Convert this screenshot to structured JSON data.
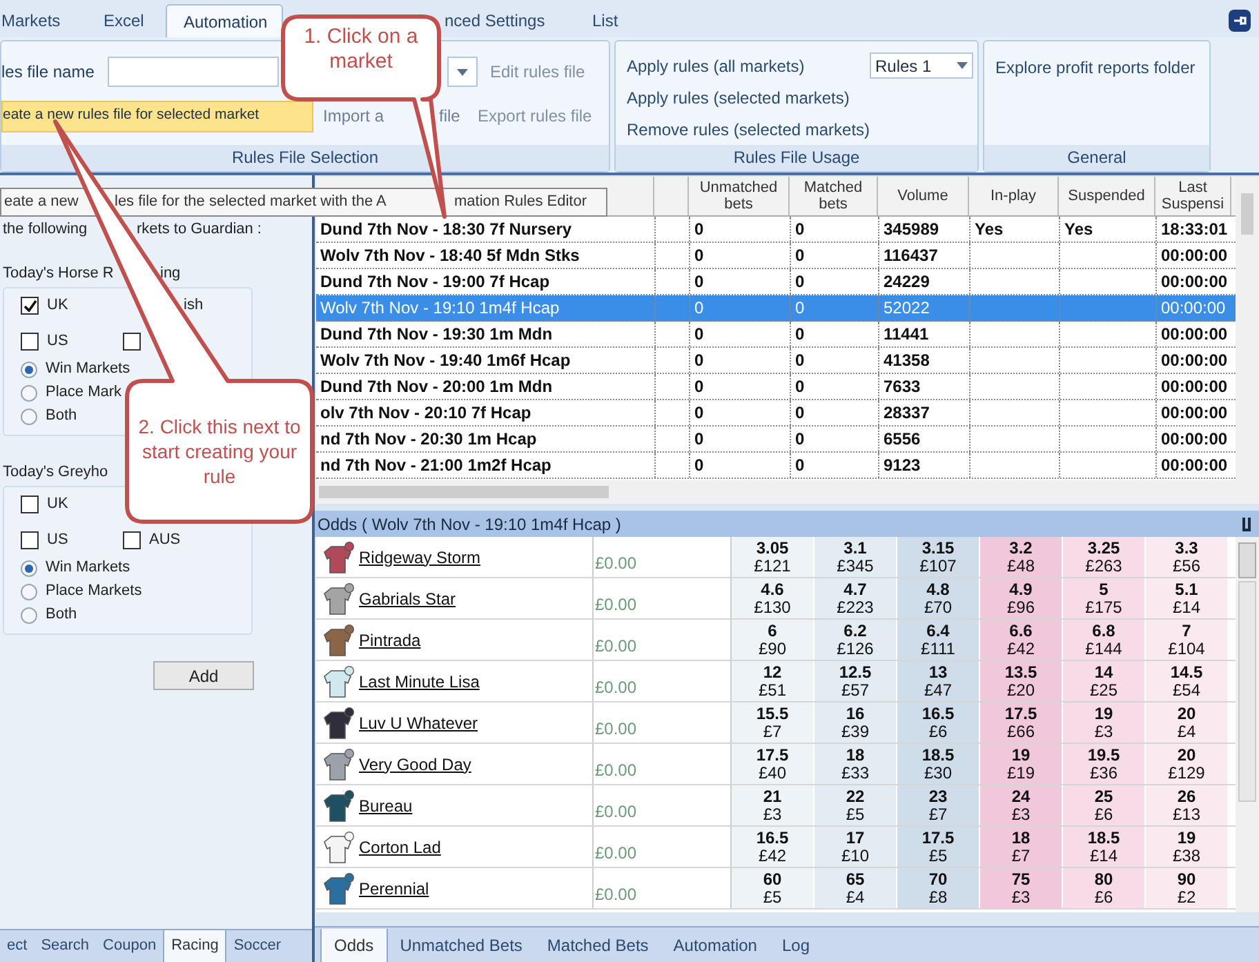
{
  "ribbon_tabs": [
    {
      "label": "Markets",
      "selected": false
    },
    {
      "label": "Excel",
      "selected": false
    },
    {
      "label": "Automation",
      "selected": true
    },
    {
      "label": "nced Settings",
      "selected": false
    },
    {
      "label": "List",
      "selected": false
    }
  ],
  "rules_selection": {
    "name_label": "les file name",
    "edit_button": "Edit rules file",
    "create_button": "eate a new rules file for selected market",
    "import_fragments": [
      "Import a",
      "file"
    ],
    "export_button": "Export rules file",
    "group_label": "Rules File Selection"
  },
  "rules_usage": {
    "actions": [
      "Apply rules (all markets)",
      "Apply rules (selected markets)",
      "Remove rules (selected markets)"
    ],
    "rules_dropdown": "Rules 1",
    "group_label": "Rules File Usage"
  },
  "general": {
    "actions": [
      "Explore profit reports folder"
    ],
    "group_label": "General"
  },
  "tooltip_fragments": [
    "eate a new",
    "les file for the selected market with the A",
    "mation Rules Editor"
  ],
  "left_panel": {
    "intro_fragments": [
      "the following",
      "rkets to Guardian :"
    ],
    "sections": [
      {
        "title_fragments": [
          "Today's Horse R",
          "ing"
        ],
        "options": [
          {
            "kind": "checkbox",
            "label": "UK",
            "checked": true
          },
          {
            "kind": "fragment",
            "label": "ish"
          },
          {
            "kind": "checkbox",
            "label": "US",
            "checked": false
          },
          {
            "kind": "checkbox",
            "checked": false
          }
        ],
        "radios": [
          {
            "label": "Win Markets",
            "selected": true
          },
          {
            "label": "Place Mark",
            "selected": false
          },
          {
            "label": "Both",
            "selected": false
          }
        ]
      },
      {
        "title_fragments": [
          "Today's Greyho"
        ],
        "options": [
          {
            "kind": "checkbox",
            "label": "UK",
            "checked": false
          },
          {
            "kind": "blank"
          },
          {
            "kind": "checkbox",
            "label": "US",
            "checked": false
          },
          {
            "kind": "checkbox",
            "label": "AUS",
            "checked": false
          }
        ],
        "radios": [
          {
            "label": "Win Markets",
            "selected": true
          },
          {
            "label": "Place Markets",
            "selected": false
          },
          {
            "label": "Both",
            "selected": false
          }
        ]
      }
    ],
    "add_button": "Add",
    "tabs": [
      {
        "label": "ect",
        "selected": false
      },
      {
        "label": "Search",
        "selected": false
      },
      {
        "label": "Coupon",
        "selected": false
      },
      {
        "label": "Racing",
        "selected": true
      },
      {
        "label": "Soccer",
        "selected": false
      }
    ]
  },
  "markets": {
    "columns": [
      "Unmatched bets",
      "Matched bets",
      "Volume",
      "In-play",
      "Suspended",
      "Last Suspensi"
    ],
    "rows": [
      {
        "name": "Dund 7th Nov - 18:30 7f Nursery",
        "cells": [
          "0",
          "0",
          "345989",
          "Yes",
          "Yes",
          "18:33:01"
        ],
        "selected": false
      },
      {
        "name": "Wolv 7th Nov - 18:40 5f Mdn Stks",
        "cells": [
          "0",
          "0",
          "116437",
          "",
          "",
          "00:00:00"
        ],
        "selected": false
      },
      {
        "name": "Dund 7th Nov - 19:00 7f Hcap",
        "cells": [
          "0",
          "0",
          "24229",
          "",
          "",
          "00:00:00"
        ],
        "selected": false
      },
      {
        "name": "Wolv 7th Nov - 19:10 1m4f Hcap",
        "cells": [
          "0",
          "0",
          "52022",
          "",
          "",
          "00:00:00"
        ],
        "selected": true
      },
      {
        "name": "Dund 7th Nov - 19:30 1m Mdn",
        "cells": [
          "0",
          "0",
          "11441",
          "",
          "",
          "00:00:00"
        ],
        "selected": false
      },
      {
        "name": "Wolv 7th Nov - 19:40 1m6f Hcap",
        "cells": [
          "0",
          "0",
          "41358",
          "",
          "",
          "00:00:00"
        ],
        "selected": false
      },
      {
        "name": "Dund 7th Nov - 20:00 1m Mdn",
        "cells": [
          "0",
          "0",
          "7633",
          "",
          "",
          "00:00:00"
        ],
        "selected": false
      },
      {
        "name": "olv 7th Nov - 20:10 7f Hcap",
        "cells": [
          "0",
          "0",
          "28337",
          "",
          "",
          "00:00:00"
        ],
        "selected": false
      },
      {
        "name": "nd 7th Nov - 20:30 1m Hcap",
        "cells": [
          "0",
          "0",
          "6556",
          "",
          "",
          "00:00:00"
        ],
        "selected": false
      },
      {
        "name": "nd 7th Nov - 21:00 1m2f Hcap",
        "cells": [
          "0",
          "0",
          "9123",
          "",
          "",
          "00:00:00"
        ],
        "selected": false
      }
    ]
  },
  "odds": {
    "title": "Odds ( Wolv 7th Nov - 19:10 1m4f Hcap )",
    "runners": [
      {
        "name": "Ridgeway Storm",
        "color": "#b04a5a",
        "profit": "£0.00",
        "prices": [
          [
            "3.05",
            "£121"
          ],
          [
            "3.1",
            "£345"
          ],
          [
            "3.15",
            "£107"
          ],
          [
            "3.2",
            "£48"
          ],
          [
            "3.25",
            "£263"
          ],
          [
            "3.3",
            "£56"
          ]
        ]
      },
      {
        "name": "Gabrials Star",
        "color": "#a4a4a4",
        "profit": "£0.00",
        "prices": [
          [
            "4.6",
            "£130"
          ],
          [
            "4.7",
            "£223"
          ],
          [
            "4.8",
            "£70"
          ],
          [
            "4.9",
            "£96"
          ],
          [
            "5",
            "£175"
          ],
          [
            "5.1",
            "£14"
          ]
        ]
      },
      {
        "name": "Pintrada",
        "color": "#8c6446",
        "profit": "£0.00",
        "prices": [
          [
            "6",
            "£90"
          ],
          [
            "6.2",
            "£126"
          ],
          [
            "6.4",
            "£111"
          ],
          [
            "6.6",
            "£42"
          ],
          [
            "6.8",
            "£144"
          ],
          [
            "7",
            "£104"
          ]
        ]
      },
      {
        "name": "Last Minute Lisa",
        "color": "#cfe9ee",
        "profit": "£0.00",
        "prices": [
          [
            "12",
            "£51"
          ],
          [
            "12.5",
            "£57"
          ],
          [
            "13",
            "£47"
          ],
          [
            "13.5",
            "£20"
          ],
          [
            "14",
            "£25"
          ],
          [
            "14.5",
            "£54"
          ]
        ]
      },
      {
        "name": "Luv U Whatever",
        "color": "#2e2e3c",
        "profit": "£0.00",
        "prices": [
          [
            "15.5",
            "£7"
          ],
          [
            "16",
            "£39"
          ],
          [
            "16.5",
            "£6"
          ],
          [
            "17.5",
            "£66"
          ],
          [
            "19",
            "£3"
          ],
          [
            "20",
            "£4"
          ]
        ]
      },
      {
        "name": "Very Good Day",
        "color": "#9ca2aa",
        "profit": "£0.00",
        "prices": [
          [
            "17.5",
            "£40"
          ],
          [
            "18",
            "£33"
          ],
          [
            "18.5",
            "£30"
          ],
          [
            "19",
            "£19"
          ],
          [
            "19.5",
            "£36"
          ],
          [
            "20",
            "£129"
          ]
        ]
      },
      {
        "name": "Bureau",
        "color": "#1f4f62",
        "profit": "£0.00",
        "prices": [
          [
            "21",
            "£3"
          ],
          [
            "22",
            "£5"
          ],
          [
            "23",
            "£7"
          ],
          [
            "24",
            "£3"
          ],
          [
            "25",
            "£6"
          ],
          [
            "26",
            "£13"
          ]
        ]
      },
      {
        "name": "Corton Lad",
        "color": "#f4f4f4",
        "profit": "£0.00",
        "prices": [
          [
            "16.5",
            "£42"
          ],
          [
            "17",
            "£10"
          ],
          [
            "17.5",
            "£5"
          ],
          [
            "18",
            "£7"
          ],
          [
            "18.5",
            "£14"
          ],
          [
            "19",
            "£38"
          ]
        ]
      },
      {
        "name": "Perennial",
        "color": "#2b6fa0",
        "profit": "£0.00",
        "prices": [
          [
            "60",
            "£5"
          ],
          [
            "65",
            "£4"
          ],
          [
            "70",
            "£8"
          ],
          [
            "75",
            "£3"
          ],
          [
            "80",
            "£6"
          ],
          [
            "90",
            "£2"
          ]
        ]
      }
    ]
  },
  "bottom_tabs": [
    {
      "label": "Odds",
      "selected": true
    },
    {
      "label": "Unmatched Bets",
      "selected": false
    },
    {
      "label": "Matched Bets",
      "selected": false
    },
    {
      "label": "Automation",
      "selected": false
    },
    {
      "label": "Log",
      "selected": false
    }
  ],
  "callouts": [
    {
      "text": "1. Click on a market"
    },
    {
      "text": "2. Click this next to start creating your rule"
    }
  ]
}
